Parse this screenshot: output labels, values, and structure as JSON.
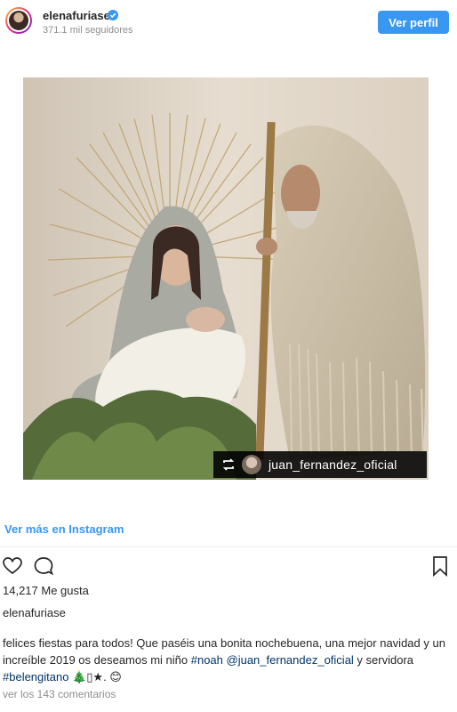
{
  "header": {
    "username": "elenafuriase",
    "followers": "371.1 mil seguidores",
    "profile_button": "Ver perfil"
  },
  "photo": {
    "repost_user": "juan_fernandez_oficial"
  },
  "more_link": "Ver más en Instagram",
  "actions": {
    "like": "heart-icon",
    "comment": "comment-icon",
    "save": "bookmark-icon"
  },
  "likes": "14,217 Me gusta",
  "caption": {
    "username": "elenafuriase",
    "text_1": "felices fiestas para todos! Que paséis una bonita nochebuena, una mejor navidad y un increíble 2019 os deseamos mi niño ",
    "tag_noah": "#noah",
    "text_2": " ",
    "tag_juan": "@juan_fernandez_oficial",
    "text_3": " y servidora ",
    "tag_belen": "#belengitano",
    "emojis": " 🎄▯★. 😊"
  },
  "comments_link": "ver los 143 comentarios",
  "colors": {
    "accent": "#3897f0",
    "hashtag": "#003569",
    "muted": "#8e8e8e"
  }
}
